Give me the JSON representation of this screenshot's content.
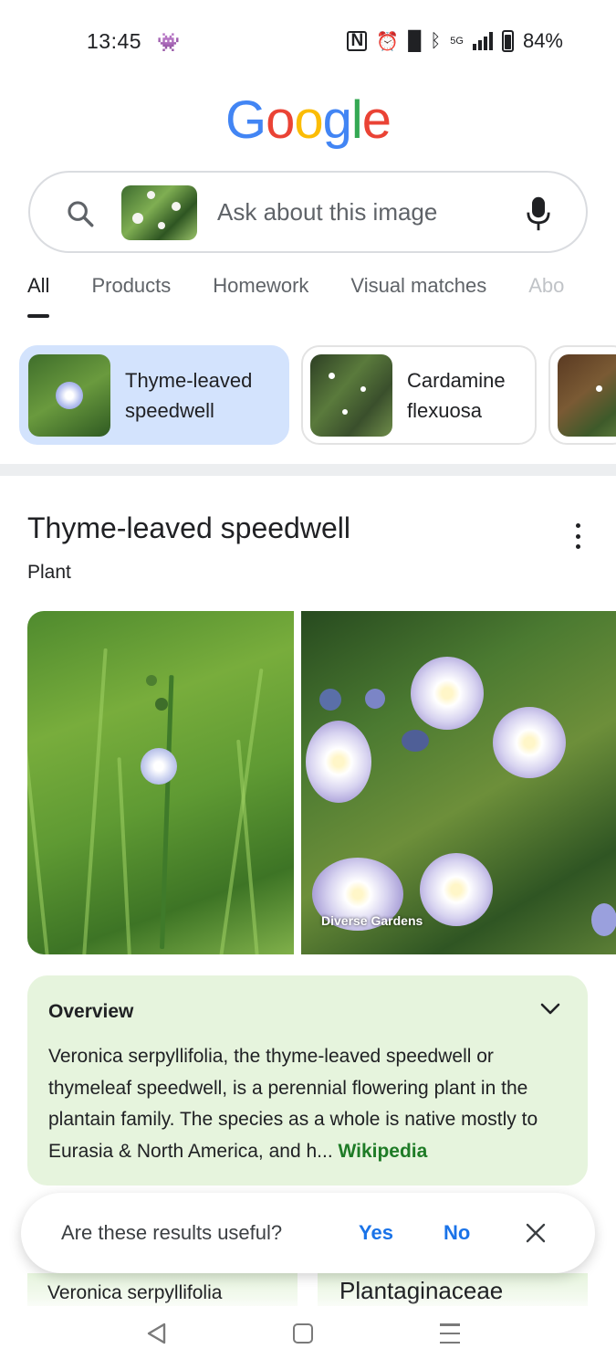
{
  "status_bar": {
    "time": "13:45",
    "battery_pct": "84%",
    "network": "5G",
    "icons": [
      "notification-icon",
      "nfc-icon",
      "alarm-icon",
      "vibrate-icon",
      "bluetooth-icon",
      "signal-icon",
      "battery-icon"
    ]
  },
  "logo": {
    "letters": [
      "G",
      "o",
      "o",
      "g",
      "l",
      "e"
    ],
    "colors": [
      "#4285F4",
      "#EA4335",
      "#FBBC05",
      "#4285F4",
      "#34A853",
      "#EA4335"
    ]
  },
  "search": {
    "placeholder": "Ask about this image"
  },
  "tabs": [
    {
      "label": "All",
      "active": true
    },
    {
      "label": "Products"
    },
    {
      "label": "Homework"
    },
    {
      "label": "Visual matches"
    },
    {
      "label": "Abo"
    }
  ],
  "chips": [
    {
      "line1": "Thyme-leaved",
      "line2": "speedwell",
      "active": true
    },
    {
      "line1": "Cardamine",
      "line2": "flexuosa"
    }
  ],
  "knowledge_panel": {
    "title": "Thyme-leaved speedwell",
    "subtitle": "Plant",
    "photo_credit": "Diverse Gardens"
  },
  "overview": {
    "title": "Overview",
    "text": "Veronica serpyllifolia, the thyme-leaved speedwell or thymeleaf speedwell, is a perennial flowering plant in the plantain family. The species as a whole is native mostly to Eurasia & North America, and h... ",
    "link": "Wikipedia"
  },
  "feedback": {
    "question": "Are these results useful?",
    "yes": "Yes",
    "no": "No"
  },
  "peek_cards": [
    "Veronica serpyllifolia",
    "Plantaginaceae"
  ],
  "colors": {
    "accent_blue": "#1a73e8",
    "chip_active": "#d3e3fd",
    "overview_bg": "#e6f4dd",
    "link_green": "#1e7b26"
  }
}
